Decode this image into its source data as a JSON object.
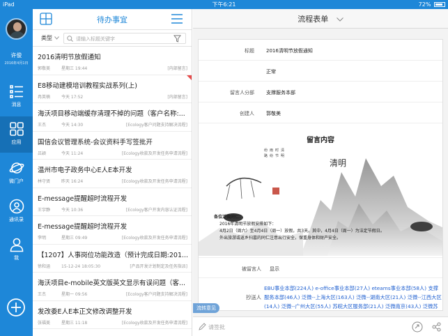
{
  "status_bar": {
    "carrier": "iPad",
    "time": "下午6:21",
    "battery": "72%"
  },
  "user": {
    "name": "许俊",
    "date": "2016年4月1日"
  },
  "rail": [
    {
      "label": "消息",
      "icon": "message-list-icon",
      "active": false
    },
    {
      "label": "应用",
      "icon": "apps-grid-icon",
      "active": true
    },
    {
      "label": "微门户",
      "icon": "planet-icon",
      "active": false
    },
    {
      "label": "通讯录",
      "icon": "contacts-icon",
      "active": false
    },
    {
      "label": "我",
      "icon": "person-icon",
      "active": false
    }
  ],
  "list": {
    "title": "待办事宜",
    "type_label": "类型",
    "search_placeholder": "请输入标题关键字",
    "items": [
      {
        "title": "2016清明节放假通知",
        "who": "郭敬美",
        "when": "星期三 19:44",
        "tag": "[内部留言]",
        "flag": false
      },
      {
        "title": "E8移动建模培训教程实战系列(上)",
        "who": "冉英楠",
        "when": "今天 17:52",
        "tag": "[内部留言]",
        "flag": true
      },
      {
        "title": "海沃项目移动端缓存清理不掉的问题（客户名称:...",
        "who": "王杰",
        "when": "今天 14:30",
        "tag": "[Ecology客户问题支持解决流程]",
        "flag": false
      },
      {
        "title": "国信会议管理系统-会议资料手写签批开",
        "who": "吕颖",
        "when": "今天 11:24",
        "tag": "[Ecology收款及开发任务申请流程]",
        "flag": false
      },
      {
        "title": "温州市电子政务中心E人E本开发",
        "who": "林守贤",
        "when": "昨天 16:24",
        "tag": "[Ecology收款及开发任务申请流程]",
        "flag": false
      },
      {
        "title": "E-message提醒超时流程开发",
        "who": "王宇静",
        "when": "今天 10:36",
        "tag": "[Ecology客户开发内容认证流程]",
        "flag": false
      },
      {
        "title": "E-message提醒超时流程开发",
        "who": "李明",
        "when": "星期三 09:49",
        "tag": "[Ecology收款及开发任务申请流程]",
        "flag": false
      },
      {
        "title": "【1207】人事岗位功能改造（预计完成日期:201...",
        "who": "徐和涵",
        "when": "15-12-24 18:05:30",
        "tag": "[产品开发计划制定及任务指派]",
        "flag": false
      },
      {
        "title": "海沃项目e-mobile英文版英文显示有误问题（客...",
        "who": "王杰",
        "when": "星期一 09:56",
        "tag": "[Ecology客户问题支持解决流程]",
        "flag": false
      },
      {
        "title": "发改委E人E本正文修改调整开发",
        "who": "张福美",
        "when": "星期三 11:18",
        "tag": "[Ecology收款及开发任务申请流程]",
        "flag": false
      }
    ]
  },
  "form": {
    "header_title": "流程表单",
    "fields": [
      {
        "key": "标题",
        "value": "2016清明节放假通知"
      },
      {
        "key": "",
        "value": "正常"
      },
      {
        "key": "留言人分部",
        "value": "支撑服务本部"
      },
      {
        "key": "创建人",
        "value": "郭敬美"
      }
    ],
    "message_title": "留言内容",
    "notice": {
      "greeting": "各位泛微同仁：",
      "line1": "2016年清明节放假安排如下：",
      "line2": "4月2日（周六）至4月4日（周一）放假，共3天。其中，4月4日（周一）为法定节假日。",
      "line3": "外出旅游或返乡扫墓的同仁注意出行安全，保重身体和财产安全。"
    },
    "painting_caption": "清明",
    "recipient": {
      "key": "被留言人",
      "value": "显示"
    },
    "cc": {
      "key": "抄送人",
      "value": "EBU事业本部(224人) e-office事业本部(27人) eteams事业本部(58人) 支撑服务本部(46人) 泛微--上海大区(163人) 泛微--湖南大区(21人) 泛微--江西大区(14人) 泛微--广州大区(55人) 苏皖大区服务部(21人) 泛微南京(43人) 泛微苏州(14人) 泛微天津(18人) 泛微北京(13人) 泛微福建(5人)"
    },
    "flow_tag": "流转意见",
    "sign_placeholder": "请签批"
  },
  "colors": {
    "brand_blue": "#1e87d8",
    "rail_active": "#1670b6",
    "link_blue": "#1e5fd0",
    "flag_red": "#e64b4b"
  }
}
